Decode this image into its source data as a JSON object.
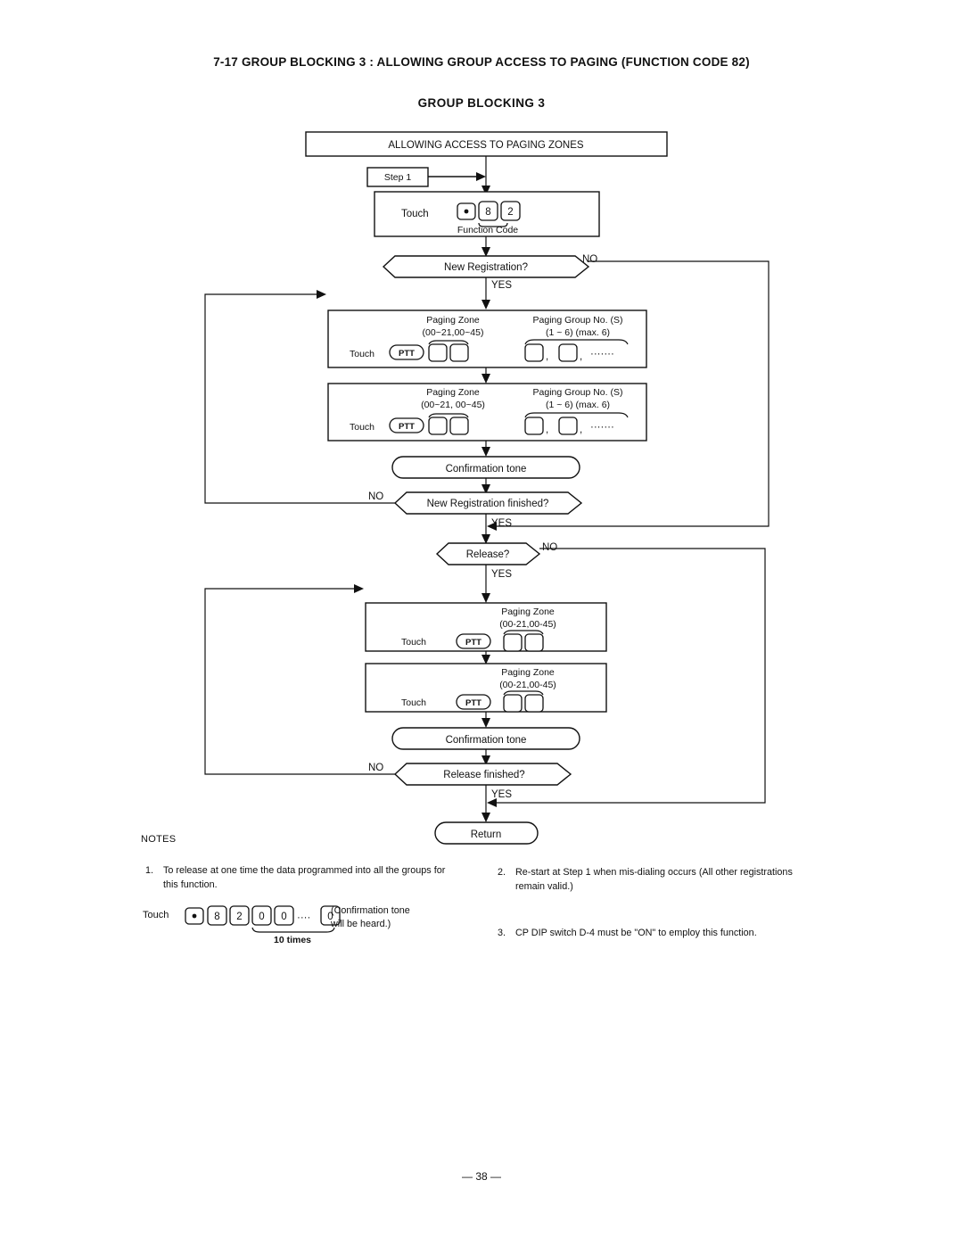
{
  "header": {
    "section_title": "7-17 GROUP BLOCKING 3 : ALLOWING GROUP ACCESS TO PAGING (FUNCTION CODE 82)",
    "chart_title": "GROUP BLOCKING 3"
  },
  "flow": {
    "start_box": "ALLOWING ACCESS TO PAGING ZONES",
    "step1_label": "Step 1",
    "touch_label": "Touch",
    "function_code_label": "Function Code",
    "function_keys": [
      "•",
      "8",
      "2"
    ],
    "decision_new_registration": "New Registration?",
    "decision_new_registration_finished": "New Registration finished?",
    "decision_release": "Release?",
    "decision_release_finished": "Release finished?",
    "confirmation_tone": "Confirmation tone",
    "return_label": "Return",
    "yes": "YES",
    "no": "NO",
    "ptt_label": "PTT",
    "reg_block": {
      "paging_zone_title": "Paging Zone",
      "paging_zone_range_1": "(00~21,00~45)",
      "paging_zone_range_2": "(00~21, 00~45)",
      "paging_group_title": "Paging Group No. (S)",
      "paging_group_range": "(1 ~ 6) (max. 6)",
      "comma": ",",
      "ellipsis": "·······"
    },
    "release_block": {
      "paging_zone_title": "Paging Zone",
      "paging_zone_range": "(00-21,00-45)"
    }
  },
  "notes": {
    "label": "NOTES",
    "items": [
      {
        "num": "1.",
        "text": "To release at one time the data programmed into all the groups for this function."
      },
      {
        "num": "2.",
        "text": "Re-start at Step 1 when mis-dialing occurs (All other registrations remain valid.)"
      },
      {
        "num": "3.",
        "text": "CP  DIP switch D-4 must be \"ON\" to employ this function."
      }
    ],
    "touch_label": "Touch",
    "key_sequence": [
      "•",
      "8",
      "2",
      "0",
      "0",
      "0"
    ],
    "ellipsis": "····",
    "times_label": "10 times",
    "confirmation_note": "(Confirmation tone\nwill be heard.)"
  },
  "footer": {
    "page_number": "— 38 —"
  }
}
